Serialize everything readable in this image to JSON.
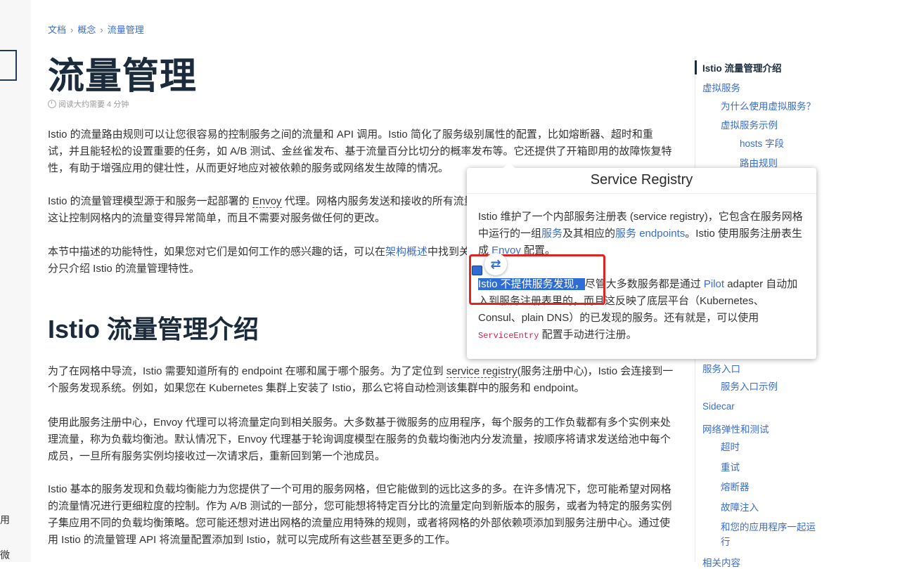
{
  "breadcrumb": {
    "items": [
      "文档",
      "概念",
      "流量管理"
    ],
    "separator": "›"
  },
  "page": {
    "title": "流量管理",
    "reading_time": "阅读大约需要 4 分钟"
  },
  "left_sidebar": {
    "text1": "用",
    "text2": "微"
  },
  "article": {
    "p1": "Istio 的流量路由规则可以让您很容易的控制服务之间的流量和 API 调用。Istio 简化了服务级别属性的配置，比如熔断器、超时和重试，并且能轻松的设置重要的任务，如 A/B 测试、金丝雀发布、基于流量百分比切分的概率发布等。它还提供了开箱即用的故障恢复特性，有助于增强应用的健壮性，从而更好地应对被依赖的服务或网络发生故障的情况。",
    "p2_a": "Istio 的流量管理模型源于和服务一起部署的 ",
    "p2_envoy": "Envoy",
    "p2_b": " 代理。网格内服务发送和接收的所有流量（data plane 流量）都经由 Envoy 代理，这让控制网格内的流量变得异常简单，而且不需要对服务做任何的更改。",
    "p3_a": "本节中描述的功能特性，如果您对它们是如何工作的感兴趣的话，可以在",
    "p3_link": "架构概述",
    "p3_b": "中找到关于 Istio 的流量管理实现的更多信息。本部分只介绍 Istio 的流量管理特性。",
    "h2": "Istio 流量管理介绍",
    "p4_a": "为了在网格中导流，Istio 需要知道所有的 endpoint 在哪和属于哪个服务。为了定位到 ",
    "p4_term": "service registry",
    "p4_b": "(服务注册中心)，Istio 会连接到一个服务发现系统。例如，如果您在 Kubernetes 集群上安装了 Istio，那么它将自动检测该集群中的服务和 endpoint。",
    "p5": "使用此服务注册中心，Envoy 代理可以将流量定向到相关服务。大多数基于微服务的应用程序，每个服务的工作负载都有多个实例来处理流量，称为负载均衡池。默认情况下，Envoy 代理基于轮询调度模型在服务的负载均衡池内分发流量，按顺序将请求发送给池中每个成员，一旦所有服务实例均接收过一次请求后，重新回到第一个池成员。",
    "p6": "Istio 基本的服务发现和负载均衡能力为您提供了一个可用的服务网格，但它能做到的远比这多的多。在许多情况下，您可能希望对网格的流量情况进行更细粒度的控制。作为 A/B 测试的一部分，您可能想将特定百分比的流量定向到新版本的服务，或者为特定的服务实例子集应用不同的负载均衡策略。您可能还想对进出网格的流量应用特殊的规则，或者将网格的外部依赖项添加到服务注册中心。通过使用 Istio 的流量管理 API 将流量配置添加到 Istio，就可以完成所有这些甚至更多的工作。"
  },
  "toc": {
    "items": [
      "Istio 流量管理介绍",
      "虚拟服务",
      "为什么使用虚拟服务？",
      "虚拟服务示例",
      "hosts 字段",
      "路由规则",
      "服务入口",
      "服务入口示例",
      "Sidecar",
      "网络弹性和测试",
      "超时",
      "重试",
      "熔断器",
      "故障注入",
      "和您的应用程序一起运",
      "行",
      "相关内容"
    ]
  },
  "popup": {
    "title": "Service Registry",
    "p1_a": "Istio 维护了一个内部服务注册表 (service registry)，它包含在服务网格中运行的一组",
    "p1_l1": "服务",
    "p1_b": "及其相应的",
    "p1_l2": "服务 endpoints",
    "p1_c": "。Istio 使用服务注册表生成 ",
    "p1_l3": "Envoy",
    "p1_d": " 配置。",
    "p2_hl": "Istio 不提供服务发现，",
    "p2_a": "尽管大多数服务都是通过 ",
    "p2_l1": "Pilot",
    "p2_b": " adapter 自动加入到服务注册表里的，而且这反映了底层平台（Kubernetes、Consul、plain DNS）的已发现的服务。还有就是，可以使用 ",
    "p2_code": "ServiceEntry",
    "p2_c": " 配置手动进行注册。"
  },
  "translate_icon": "⇄",
  "colors": {
    "link": "#3a6cc9",
    "heading": "#1c2b3c",
    "highlight": "#2f6dd5",
    "selection_border": "#e02424"
  }
}
